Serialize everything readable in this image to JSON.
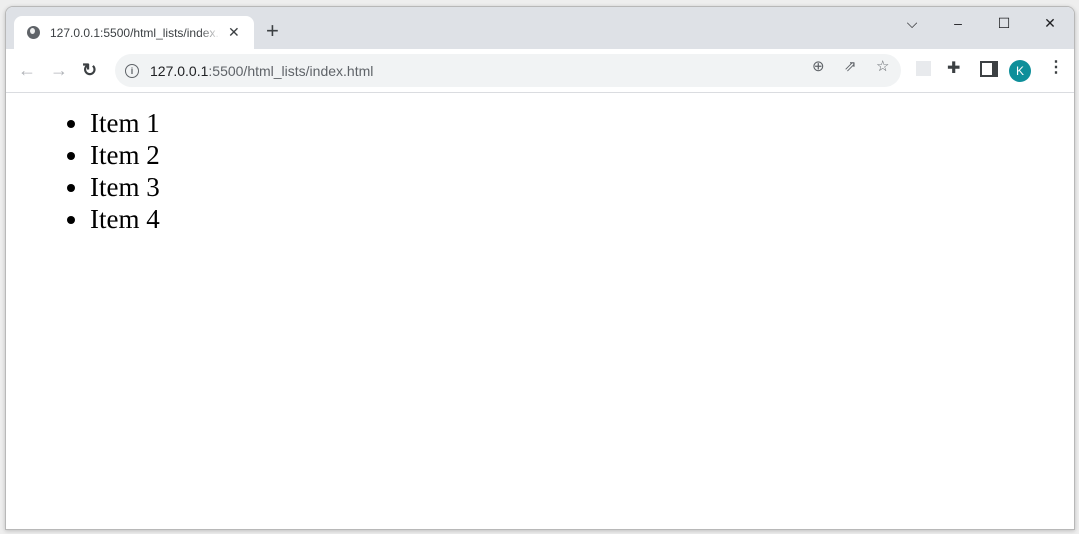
{
  "tab": {
    "title": "127.0.0.1:5500/html_lists/index.html",
    "icon": "globe-icon"
  },
  "address": {
    "host": "127.0.0.1",
    "rest": ":5500/html_lists/index.html"
  },
  "avatar": {
    "letter": "K",
    "color": "#0e8f9a"
  },
  "list": {
    "items": [
      "Item 1",
      "Item 2",
      "Item 3",
      "Item 4"
    ]
  }
}
